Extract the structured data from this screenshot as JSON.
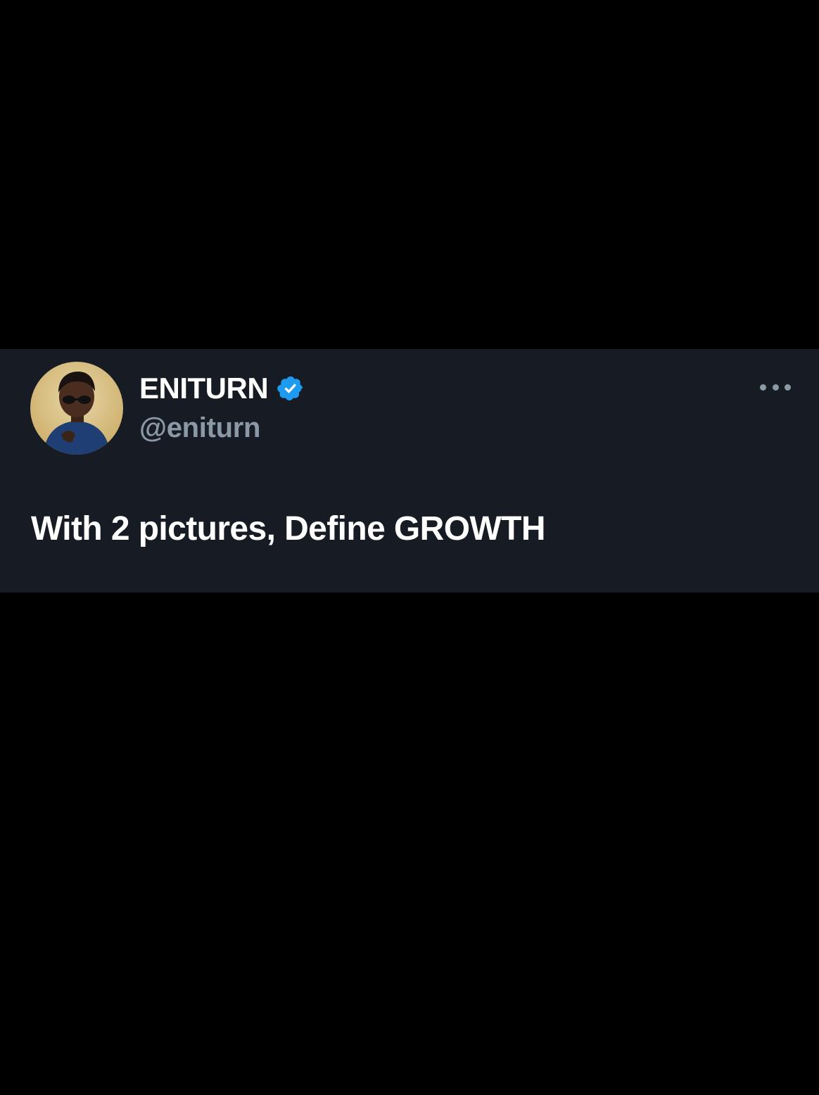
{
  "tweet": {
    "author": {
      "display_name": "ENITURN",
      "handle": "@eniturn",
      "verified": true,
      "avatar_icon": "user-avatar-photo"
    },
    "text": "With 2 pictures, Define GROWTH",
    "more_icon": "more-horizontal-icon"
  },
  "colors": {
    "page_background": "#000000",
    "card_background": "#171c24",
    "primary_text": "#ffffff",
    "secondary_text": "#8b98a5",
    "verified_badge": "#1d9bf0"
  }
}
